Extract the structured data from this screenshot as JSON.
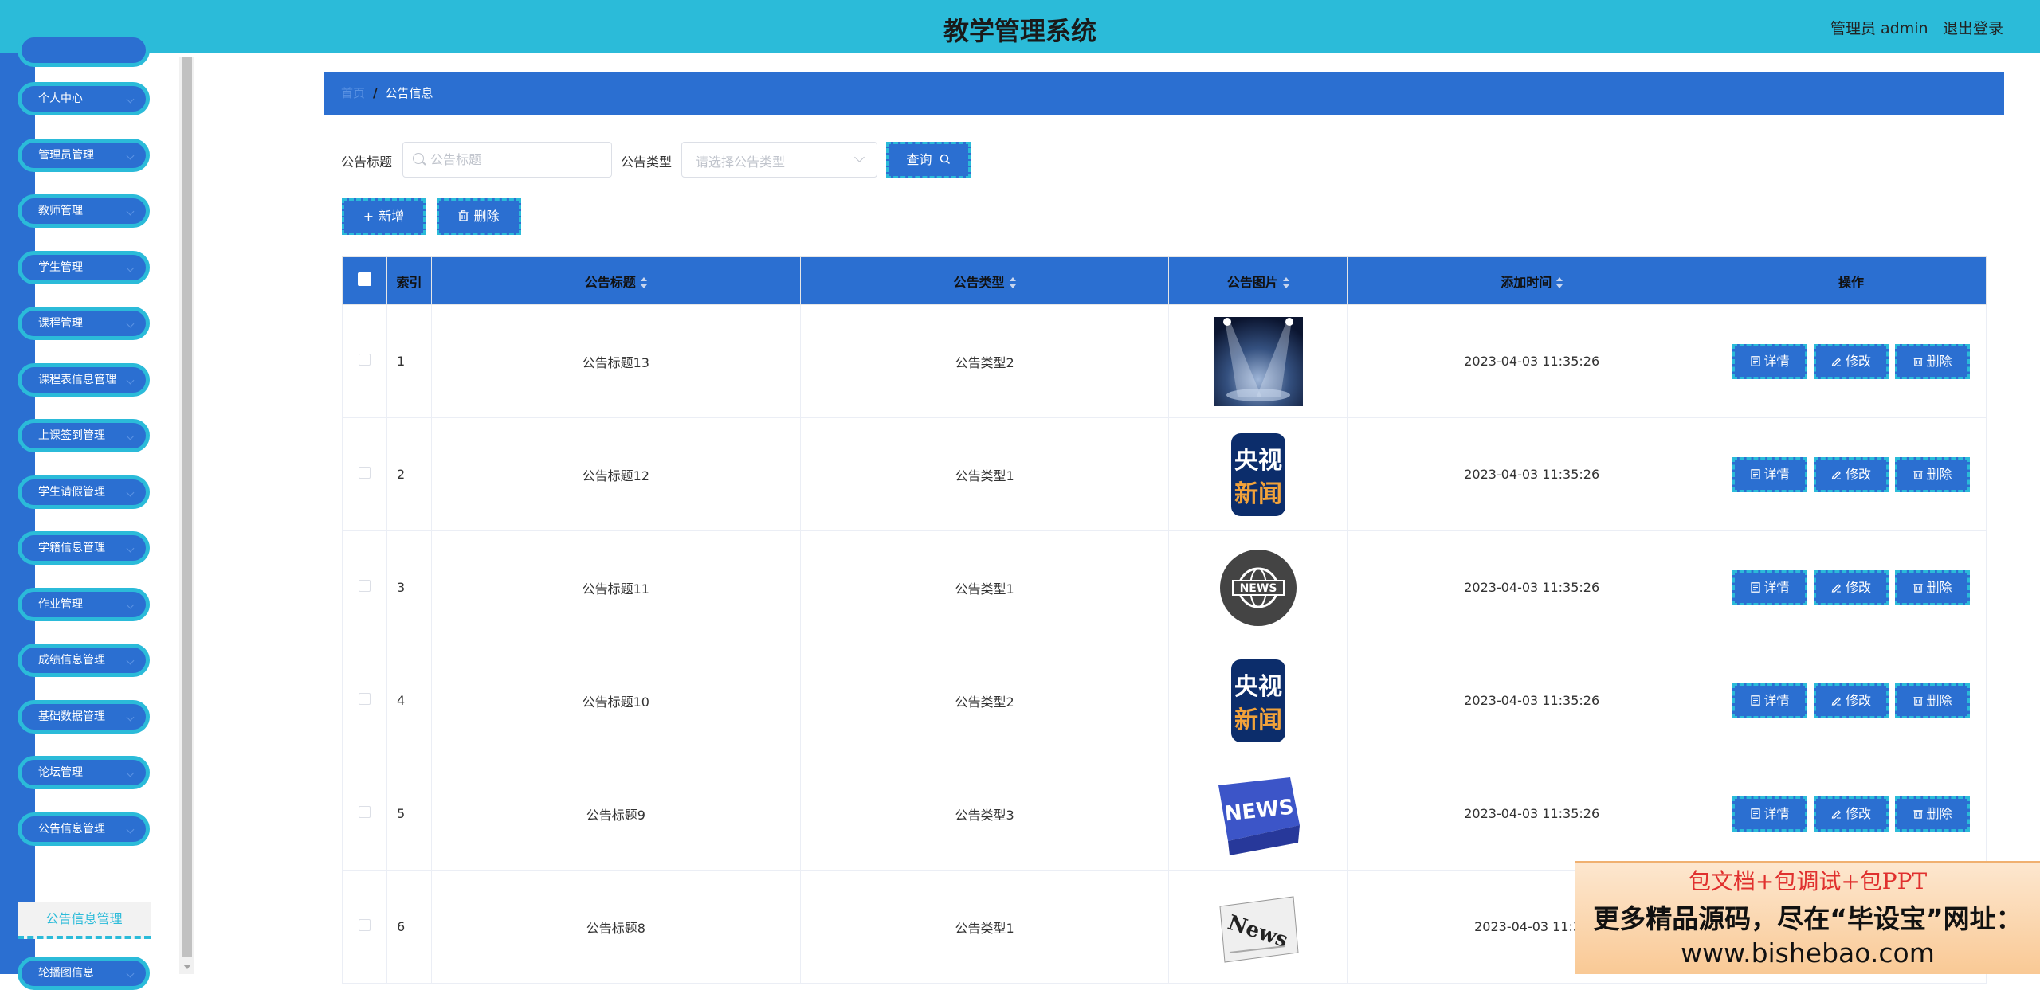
{
  "header": {
    "title": "教学管理系统",
    "admin_label": "管理员 admin",
    "logout_label": "退出登录"
  },
  "sidebar": {
    "items": [
      {
        "label": "个人中心"
      },
      {
        "label": "管理员管理"
      },
      {
        "label": "教师管理"
      },
      {
        "label": "学生管理"
      },
      {
        "label": "课程管理"
      },
      {
        "label": "课程表信息管理"
      },
      {
        "label": "上课签到管理"
      },
      {
        "label": "学生请假管理"
      },
      {
        "label": "学籍信息管理"
      },
      {
        "label": "作业管理"
      },
      {
        "label": "成绩信息管理"
      },
      {
        "label": "基础数据管理"
      },
      {
        "label": "论坛管理"
      },
      {
        "label": "公告信息管理"
      },
      {
        "label": "轮播图信息"
      }
    ],
    "active_submenu": "公告信息管理"
  },
  "breadcrumb": {
    "home": "首页",
    "separator": "/",
    "current": "公告信息"
  },
  "search": {
    "title_label": "公告标题",
    "title_placeholder": "公告标题",
    "type_label": "公告类型",
    "type_placeholder": "请选择公告类型",
    "query_button": "查询",
    "add_button": "新增",
    "delete_button": "删除"
  },
  "table": {
    "headers": {
      "index": "索引",
      "title": "公告标题",
      "type": "公告类型",
      "image": "公告图片",
      "time": "添加时间",
      "actions": "操作"
    },
    "action_labels": {
      "detail": "详情",
      "edit": "修改",
      "delete": "删除"
    },
    "rows": [
      {
        "index": "1",
        "title": "公告标题13",
        "type": "公告类型2",
        "image": "stage-spotlight-image",
        "time": "2023-04-03 11:35:26"
      },
      {
        "index": "2",
        "title": "公告标题12",
        "type": "公告类型1",
        "image": "cctv-news-logo",
        "time": "2023-04-03 11:35:26"
      },
      {
        "index": "3",
        "title": "公告标题11",
        "type": "公告类型1",
        "image": "globe-news-icon",
        "time": "2023-04-03 11:35:26"
      },
      {
        "index": "4",
        "title": "公告标题10",
        "type": "公告类型2",
        "image": "cctv-news-logo",
        "time": "2023-04-03 11:35:26"
      },
      {
        "index": "5",
        "title": "公告标题9",
        "type": "公告类型3",
        "image": "news-key-image",
        "time": "2023-04-03 11:35:26"
      },
      {
        "index": "6",
        "title": "公告标题8",
        "type": "公告类型1",
        "image": "newspaper-image",
        "time": "2023-04-03 11:35"
      }
    ]
  },
  "ad": {
    "line1": "包文档+包调试+包PPT",
    "line2": "更多精品源码，尽在“毕设宝”网址：",
    "line3": "www.bishebao.com"
  },
  "colors": {
    "header_bg": "#2bbbd9",
    "primary_blue": "#2b6fd1",
    "accent_cyan": "#2bbbd9"
  }
}
